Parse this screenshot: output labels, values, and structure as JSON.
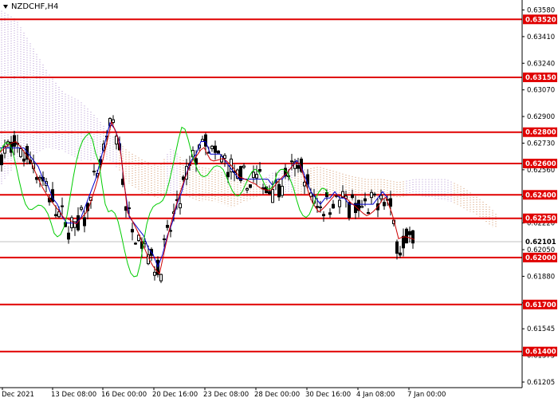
{
  "window": {
    "symbol_label": "NZDCHF,H4"
  },
  "chart_data": {
    "type": "candlestick",
    "symbol": "NZDCHF",
    "timeframe": "H4",
    "ylim": [
      0.61205,
      0.63608
    ],
    "y_ticks": [
      "0.63580",
      "0.63410",
      "0.63240",
      "0.63070",
      "0.62900",
      "0.62730",
      "0.62560",
      "0.62390",
      "0.62220",
      "0.62050",
      "0.61880",
      "0.61710",
      "0.61545",
      "0.61375",
      "0.61205"
    ],
    "x_ticks": [
      "8 Dec 2021",
      "13 Dec 08:00",
      "16 Dec 00:00",
      "20 Dec 16:00",
      "23 Dec 08:00",
      "28 Dec 00:00",
      "30 Dec 16:00",
      "4 Jan 08:00",
      "7 Jan 00:00"
    ],
    "current_price": "0.62101",
    "levels": [
      {
        "value": 0.6352,
        "label": "0.63520"
      },
      {
        "value": 0.6315,
        "label": "0.63150"
      },
      {
        "value": 0.628,
        "label": "0.62800"
      },
      {
        "value": 0.626,
        "label": "0.62600"
      },
      {
        "value": 0.624,
        "label": "0.62400"
      },
      {
        "value": 0.6225,
        "label": "0.62250"
      },
      {
        "value": 0.62,
        "label": "0.62000"
      },
      {
        "value": 0.617,
        "label": "0.61700"
      },
      {
        "value": 0.614,
        "label": "0.61400"
      }
    ],
    "colors": {
      "level_line": "#e00000",
      "candle": "#000000",
      "kijun": "#0000cc",
      "tenkan": "#cc0000",
      "chikou": "#00cc00",
      "cloud_a": "#d09060",
      "cloud_b": "#b090d0",
      "price_marker": "#222222"
    }
  }
}
